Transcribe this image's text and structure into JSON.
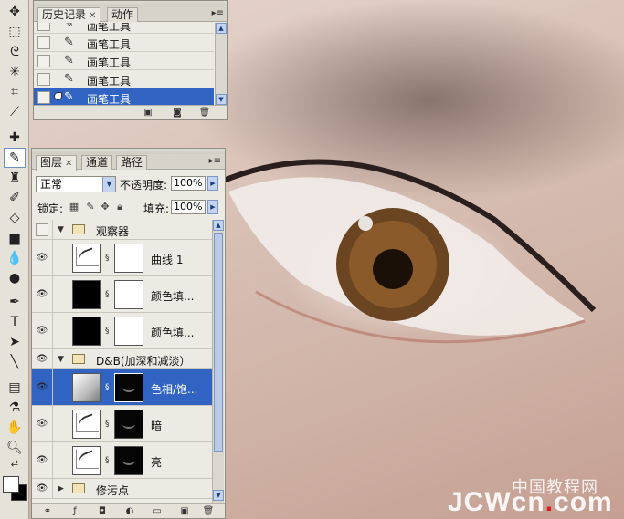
{
  "history_panel": {
    "tabs": [
      {
        "label": "历史记录"
      },
      {
        "label": "动作"
      }
    ],
    "items": [
      {
        "label": "画笔工具"
      },
      {
        "label": "画笔工具"
      },
      {
        "label": "画笔工具"
      },
      {
        "label": "画笔工具"
      },
      {
        "label": "画笔工具"
      }
    ],
    "selected_index": 4
  },
  "layers_panel": {
    "tabs": [
      {
        "label": "图层"
      },
      {
        "label": "通道"
      },
      {
        "label": "路径"
      }
    ],
    "blend_mode": "正常",
    "opacity_label": "不透明度:",
    "opacity_value": "100%",
    "lock_label": "锁定:",
    "fill_label": "填充:",
    "fill_value": "100%",
    "layers": [
      {
        "name": "观察器",
        "kind": "group",
        "visible": false
      },
      {
        "name": "曲线 1",
        "kind": "adjustment",
        "visible": true
      },
      {
        "name": "颜色填...",
        "kind": "fill",
        "visible": true
      },
      {
        "name": "颜色填...",
        "kind": "fill",
        "visible": true
      },
      {
        "name": "D&B(加深和减淡）",
        "kind": "group",
        "visible": true
      },
      {
        "name": "色相/饱...",
        "kind": "adjustment",
        "visible": true,
        "selected": true
      },
      {
        "name": "暗",
        "kind": "adjustment",
        "visible": true
      },
      {
        "name": "亮",
        "kind": "adjustment",
        "visible": true
      },
      {
        "name": "修污点",
        "kind": "group",
        "visible": true
      }
    ]
  },
  "watermark": {
    "cn": "中国教程网",
    "en_prefix": "JCWcn",
    "en_dot": ".",
    "en_suffix": "com"
  },
  "colors": {
    "selection": "#3164c2",
    "panel_bg": "#ecebe3",
    "foreground": "#ffffff",
    "background": "#000000"
  }
}
